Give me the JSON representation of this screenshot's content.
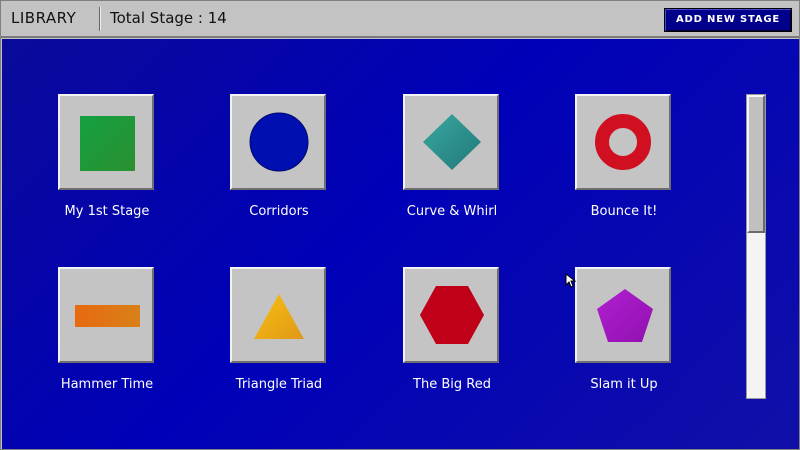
{
  "header": {
    "title": "LIBRARY",
    "total_label": "Total Stage : 14",
    "add_button": "ADD NEW STAGE"
  },
  "stages": [
    {
      "name": "My 1st Stage",
      "icon": "green-square-icon",
      "color": "#1a9a3a"
    },
    {
      "name": "Corridors",
      "icon": "blue-circle-icon",
      "color": "#0010b0"
    },
    {
      "name": "Curve & Whirl",
      "icon": "teal-diamond-icon",
      "color": "#2a9090"
    },
    {
      "name": "Bounce It!",
      "icon": "red-ring-icon",
      "color": "#d01020"
    },
    {
      "name": "Hammer Time",
      "icon": "orange-rectangle-icon",
      "color": "#e07010"
    },
    {
      "name": "Triangle Triad",
      "icon": "yellow-triangle-icon",
      "color": "#f0b010"
    },
    {
      "name": "The Big Red",
      "icon": "red-hexagon-icon",
      "color": "#c00018"
    },
    {
      "name": "Slam it Up",
      "icon": "purple-pentagon-icon",
      "color": "#a010c0"
    }
  ],
  "colors": {
    "accent": "#00008b",
    "background": "#0000b8",
    "tile": "#c4c4c4"
  }
}
